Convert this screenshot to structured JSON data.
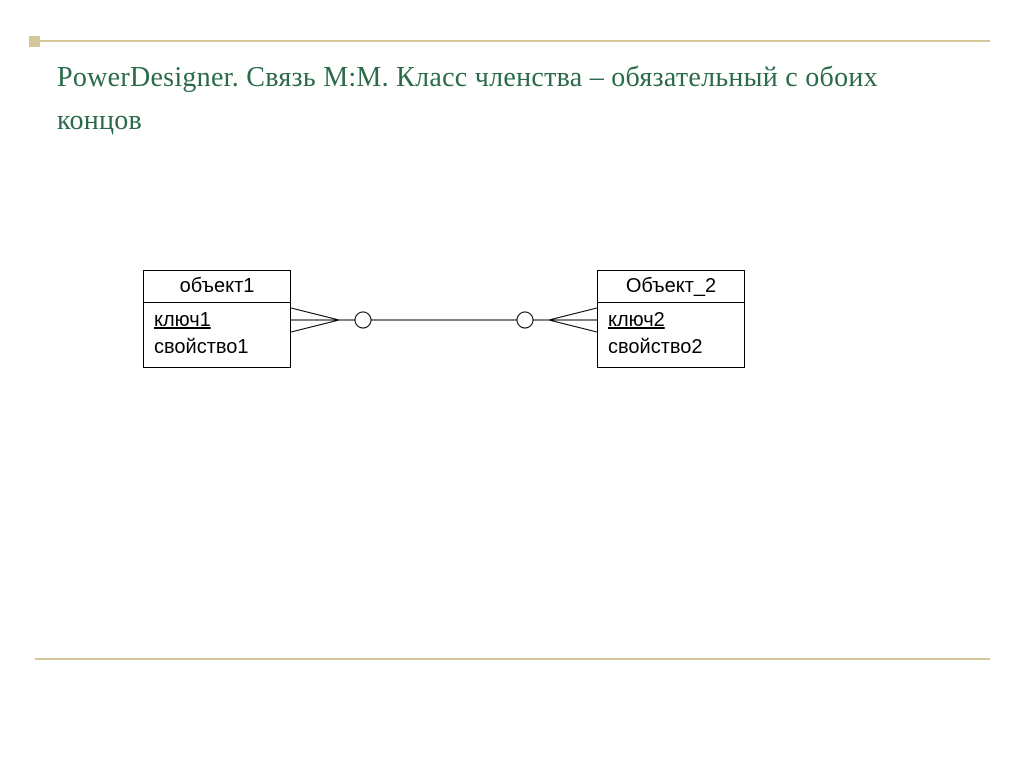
{
  "title": "PowerDesigner. Связь M:M. Класс членства – обязательный с обоих концов",
  "diagram": {
    "entity1": {
      "name": "объект1",
      "pk": "ключ1",
      "attr": "свойство1"
    },
    "entity2": {
      "name": "Объект_2",
      "pk": "ключ2",
      "attr": "свойство2"
    },
    "relation": {
      "cardinality": "M:M",
      "mandatory": "both"
    }
  }
}
